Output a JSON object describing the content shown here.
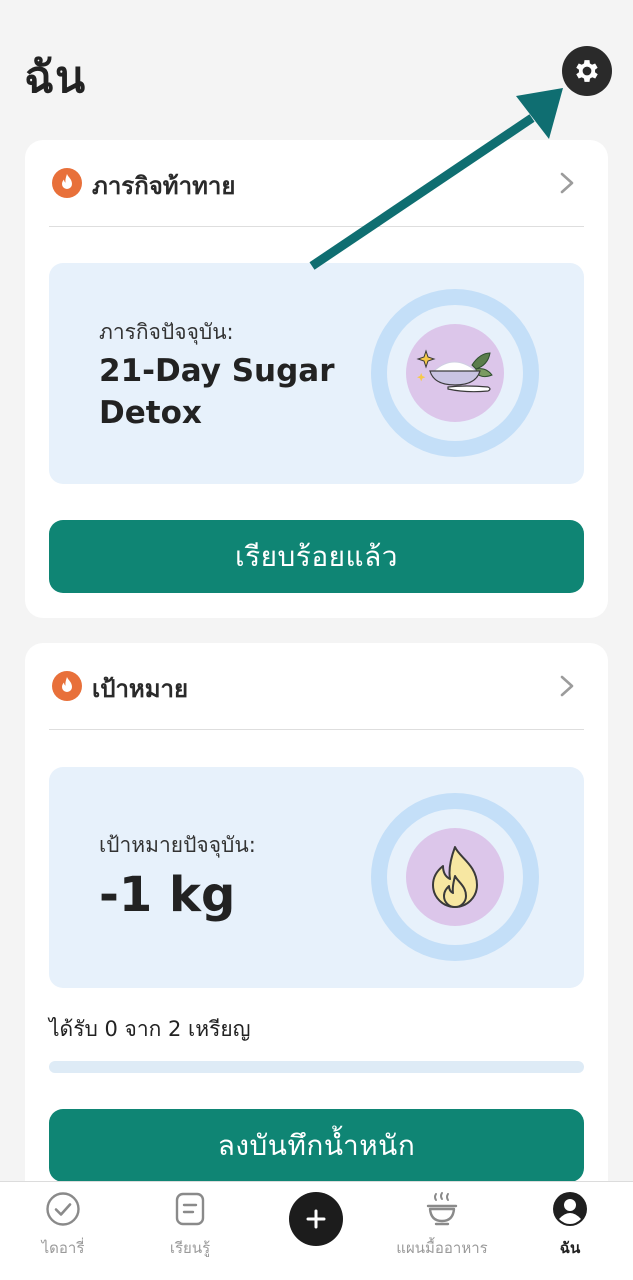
{
  "page": {
    "title": "ฉัน"
  },
  "header": {
    "settings_icon": "gear-icon"
  },
  "challenge_card": {
    "title": "ภารกิจท้าทาย",
    "current_label": "ภารกิจปัจจุบัน:",
    "current_value_line1": "21-Day Sugar",
    "current_value_line2": "Detox",
    "badge_icon": "sugar-bowl-icon",
    "button_label": "เรียบร้อยแล้ว"
  },
  "goal_card": {
    "title": "เป้าหมาย",
    "current_label": "เป้าหมายปัจจุบัน:",
    "current_value": "-1 kg",
    "badge_icon": "flame-icon",
    "medals_text": "ได้รับ 0 จาก 2 เหรียญ",
    "medals_progress": 0,
    "button_label": "ลงบันทึกน้ำหนัก"
  },
  "tab_bar": {
    "items": [
      {
        "label": "ไดอารี่",
        "icon": "check-circle-icon",
        "active": false
      },
      {
        "label": "เรียนรู้",
        "icon": "article-icon",
        "active": false
      },
      {
        "label": "",
        "icon": "plus-icon",
        "active": false
      },
      {
        "label": "แผนมื้ออาหาร",
        "icon": "bowl-icon",
        "active": false
      },
      {
        "label": "ฉัน",
        "icon": "user-icon",
        "active": true
      }
    ]
  },
  "colors": {
    "primary": "#0f8574",
    "flame": "#e8703a",
    "panel": "#e7f1fb",
    "annotation_arrow": "#0f6e71"
  }
}
